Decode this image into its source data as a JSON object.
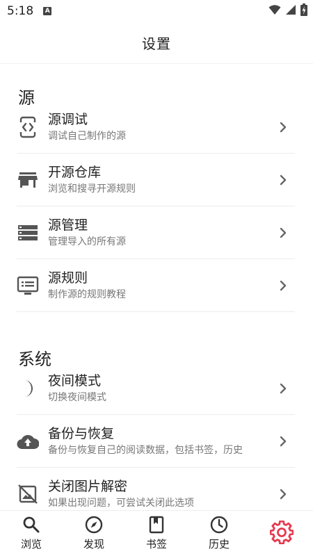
{
  "status_bar": {
    "time": "5:18",
    "notification_icon": "A"
  },
  "app_bar": {
    "title": "设置"
  },
  "sections": [
    {
      "header": "源",
      "items": [
        {
          "label": "源调试",
          "desc": "调试自己制作的源",
          "icon": "code-icon"
        },
        {
          "label": "开源仓库",
          "desc": "浏览和搜寻开源规则",
          "icon": "store-icon"
        },
        {
          "label": "源管理",
          "desc": "管理导入的所有源",
          "icon": "list-storage-icon"
        },
        {
          "label": "源规则",
          "desc": "制作源的规则教程",
          "icon": "monitor-text-icon"
        }
      ]
    },
    {
      "header": "系统",
      "items": [
        {
          "label": "夜间模式",
          "desc": "切换夜间模式",
          "icon": "moon-icon"
        },
        {
          "label": "备份与恢复",
          "desc": "备份与恢复自己的阅读数据，包括书签，历史",
          "icon": "cloud-upload-icon"
        },
        {
          "label": "关闭图片解密",
          "desc": "如果出现问题，可尝试关闭此选项",
          "icon": "image-off-icon"
        }
      ]
    }
  ],
  "bottom_nav": {
    "items": [
      {
        "label": "浏览",
        "icon": "search-icon"
      },
      {
        "label": "发现",
        "icon": "compass-icon"
      },
      {
        "label": "书签",
        "icon": "bookmark-icon"
      },
      {
        "label": "历史",
        "icon": "clock-icon"
      },
      {
        "label": "",
        "icon": "gear-icon"
      }
    ],
    "active_index": 4
  },
  "colors": {
    "accent": "#e8384f",
    "text": "#222222",
    "secondary_text": "#777777",
    "icon": "#555555"
  }
}
